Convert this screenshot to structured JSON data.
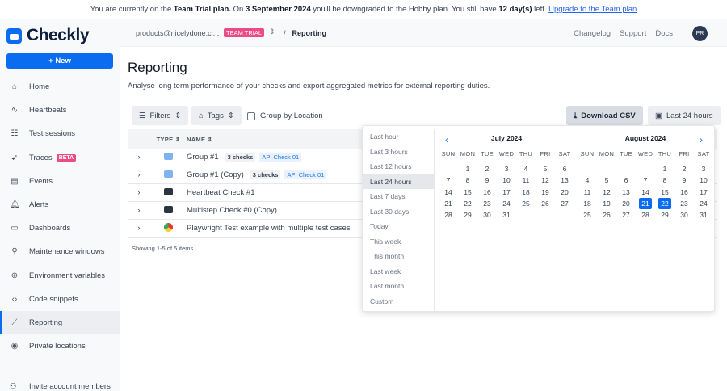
{
  "banner": {
    "t1": "You are currently on the ",
    "plan": "Team Trial plan.",
    "t2": " On ",
    "date": "3 September 2024",
    "t3": " you'll be downgraded to the Hobby plan. You still have ",
    "days": "12 day(s)",
    "t4": " left. ",
    "link": "Upgrade to the Team plan"
  },
  "brand": {
    "name": "Checkly",
    "accent": "#0b6cf0"
  },
  "sidebar": {
    "new_label": "New",
    "items": [
      {
        "label": "Home",
        "icon": "⌂"
      },
      {
        "label": "Heartbeats",
        "icon": "∿"
      },
      {
        "label": "Test sessions",
        "icon": "☷"
      },
      {
        "label": "Traces",
        "icon": "➹",
        "badge": "BETA"
      },
      {
        "label": "Events",
        "icon": "▤"
      },
      {
        "label": "Alerts",
        "icon": "🔔︎"
      },
      {
        "label": "Dashboards",
        "icon": "▭"
      },
      {
        "label": "Maintenance windows",
        "icon": "⚲"
      },
      {
        "label": "Environment variables",
        "icon": "⊕"
      },
      {
        "label": "Code snippets",
        "icon": "‹›"
      },
      {
        "label": "Reporting",
        "icon": "⟋"
      },
      {
        "label": "Private locations",
        "icon": "◉"
      }
    ],
    "invite": "Invite account members"
  },
  "topbar": {
    "account": "products@nicelydone.cl...",
    "badge": "TEAM TRIAL",
    "sep": "/",
    "page": "Reporting",
    "links": [
      "Changelog",
      "Support",
      "Docs"
    ],
    "avatar": "PR"
  },
  "page": {
    "title": "Reporting",
    "subtitle": "Analyse long term performance of your checks and export aggregated metrics for external reporting duties."
  },
  "toolbar": {
    "filters": "Filters",
    "tags": "Tags",
    "group_by": "Group by Location",
    "download": "Download CSV",
    "range": "Last 24 hours"
  },
  "table": {
    "headers": [
      "TYPE",
      "NAME"
    ],
    "rows": [
      {
        "name": "Group #1",
        "count": "3 checks",
        "tag": "API Check 01"
      },
      {
        "name": "Group #1 (Copy)",
        "count": "3 checks",
        "tag": "API Check 01"
      },
      {
        "name": "Heartbeat Check #1"
      },
      {
        "name": "Multistep Check #0 (Copy)"
      },
      {
        "name": "Playwright Test example with multiple test cases"
      }
    ],
    "footer": "Showing 1-5 of 5 items"
  },
  "picker": {
    "presets": [
      "Last hour",
      "Last 3 hours",
      "Last 12 hours",
      "Last 24 hours",
      "Last 7 days",
      "Last 30 days",
      "Today",
      "This week",
      "This month",
      "Last week",
      "Last month",
      "Custom"
    ],
    "selected": "Last 24 hours",
    "weekdays": [
      "SUN",
      "MON",
      "TUE",
      "WED",
      "THU",
      "FRI",
      "SAT"
    ],
    "months": [
      {
        "title": "July 2024",
        "offset": 1,
        "days": 31
      },
      {
        "title": "August 2024",
        "offset": 4,
        "days": 31
      }
    ],
    "range_start": {
      "month": 1,
      "day": 21
    },
    "range_end": {
      "month": 1,
      "day": 22
    }
  }
}
